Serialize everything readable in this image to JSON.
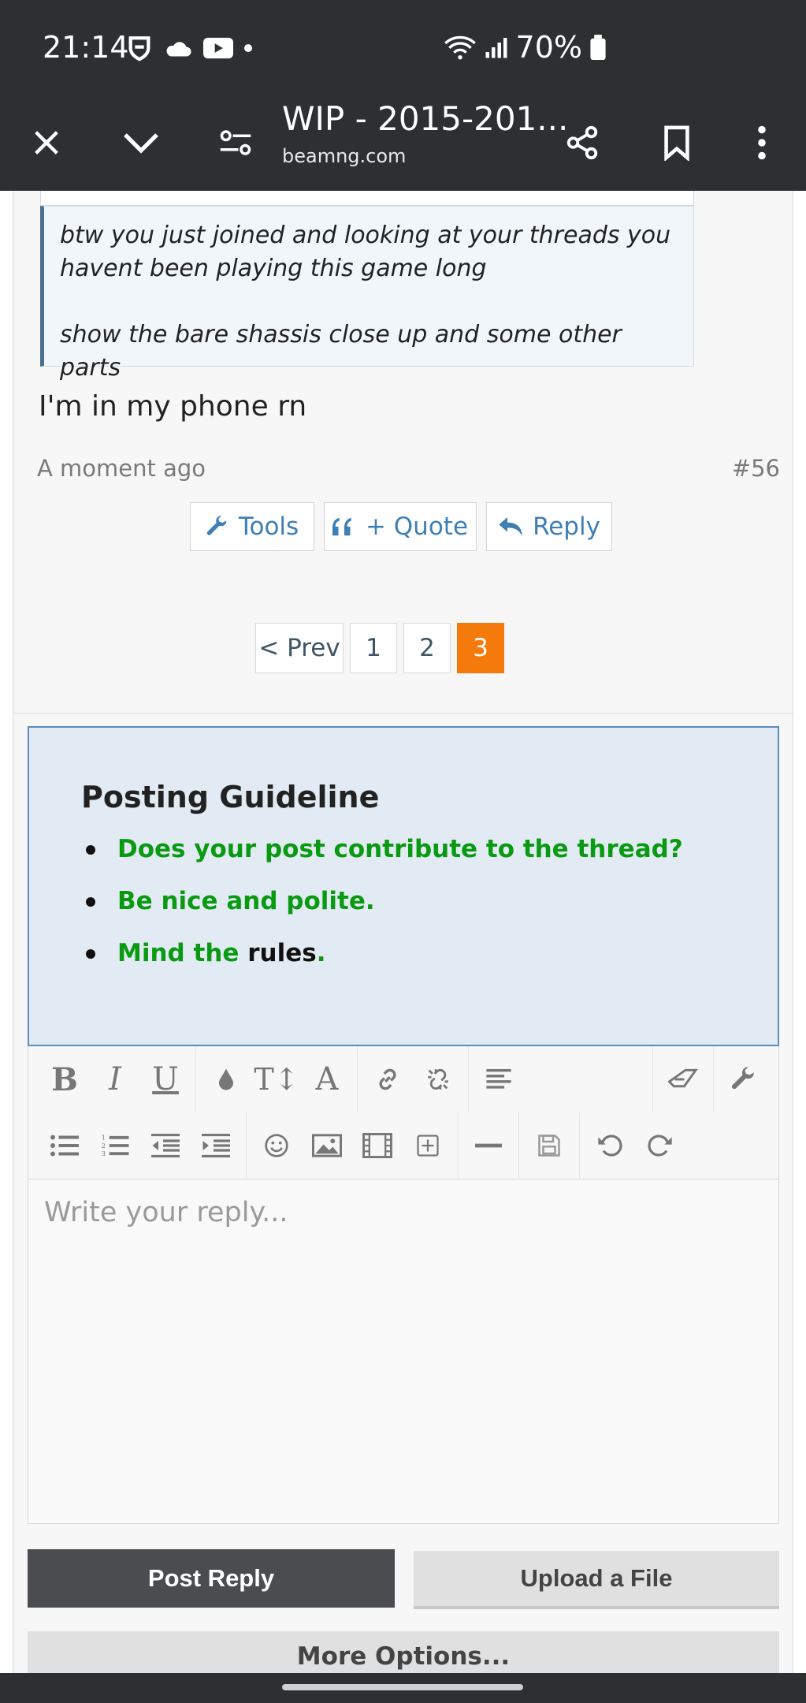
{
  "status_bar": {
    "time": "21:14",
    "battery": "70%",
    "left_icons": [
      "vpn-shield-icon",
      "cloud-icon",
      "youtube-icon",
      "notification-dot"
    ],
    "right_icons": [
      "wifi-icon",
      "signal-icon",
      "battery-icon"
    ]
  },
  "toolbar": {
    "title": "WIP - 2015-201...",
    "domain": "beamng.com",
    "icons": [
      "close-icon",
      "chevron-down-icon",
      "tune-icon",
      "share-icon",
      "bookmark-icon",
      "more-vert-icon"
    ]
  },
  "post": {
    "quote_lines": [
      "btw you just joined and looking at your threads you",
      "havent been playing this game long",
      "show the bare shassis close up and some other parts"
    ],
    "message": "I'm in my phone rn",
    "time": "A moment ago",
    "number": "#56",
    "buttons": {
      "tools": "Tools",
      "quote": "+ Quote",
      "reply": "Reply"
    }
  },
  "pagination": {
    "prev": "< Prev",
    "pages": [
      "1",
      "2",
      "3"
    ],
    "active": "3"
  },
  "guideline": {
    "title": "Posting Guideline",
    "items": [
      "Does your post contribute to the thread?",
      "Be nice and polite."
    ],
    "rules_prefix": "Mind the ",
    "rules_link": "rules",
    "rules_suffix": "."
  },
  "editor": {
    "row1": [
      "bold-icon",
      "italic-icon",
      "underline-icon",
      "text-color-icon",
      "font-size-icon",
      "font-family-icon",
      "link-icon",
      "unlink-icon",
      "align-icon",
      "remove-format-icon",
      "tools-icon"
    ],
    "row2": [
      "bulleted-list-icon",
      "numbered-list-icon",
      "outdent-icon",
      "indent-icon",
      "smilie-icon",
      "image-icon",
      "media-icon",
      "insert-icon",
      "horizontal-rule-icon",
      "save-draft-icon",
      "undo-icon",
      "redo-icon"
    ],
    "placeholder": "Write your reply...",
    "value": ""
  },
  "actions": {
    "post_reply": "Post Reply",
    "upload": "Upload a File",
    "more_options": "More Options..."
  },
  "colors": {
    "system_bar": "#2d2f31",
    "link_blue": "#3f7fb3",
    "active_page": "#f37a0b",
    "guideline_green": "#0a9a12",
    "guideline_bg": "#e2ebf3"
  }
}
